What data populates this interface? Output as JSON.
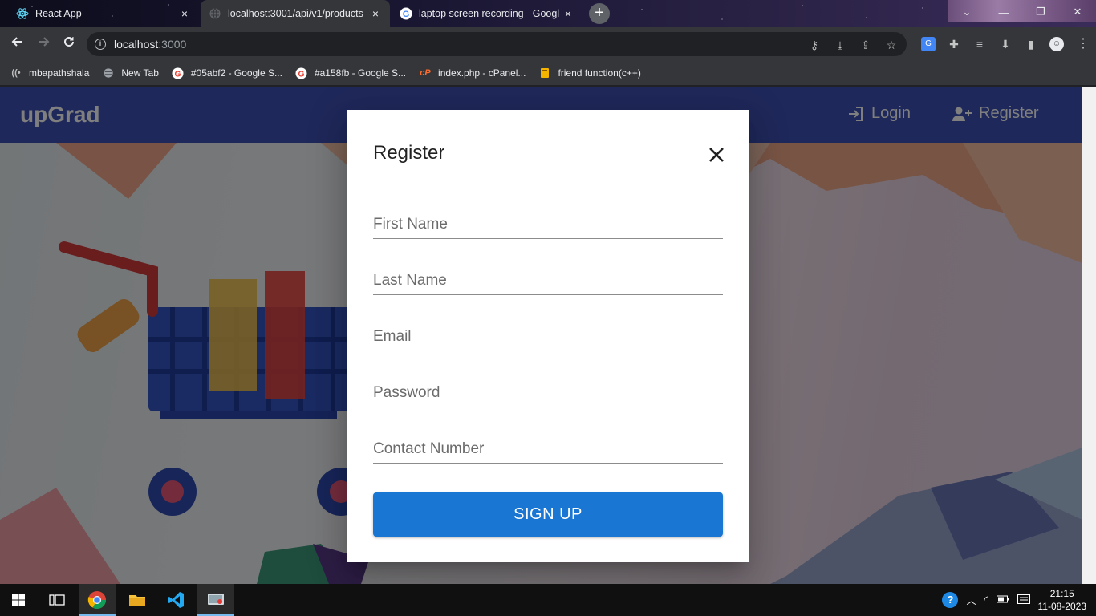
{
  "browser": {
    "tabs": [
      {
        "title": "React App",
        "icon": "react-icon",
        "close": "×"
      },
      {
        "title": "localhost:3001/api/v1/products",
        "icon": "globe-icon",
        "close": "×"
      },
      {
        "title": "laptop screen recording - Googl",
        "icon": "google-icon",
        "close": "×"
      }
    ],
    "new_tab": "+",
    "window_controls": {
      "chevron": "⌄",
      "minimize": "—",
      "restore": "❐",
      "close": "✕"
    },
    "address": {
      "host": "localhost",
      "port": ":3000"
    },
    "bookmarks": [
      {
        "label": "mbapathshala",
        "icon": "mba-icon"
      },
      {
        "label": "New Tab",
        "icon": "globe-icon"
      },
      {
        "label": "#05abf2 - Google S...",
        "icon": "google-icon"
      },
      {
        "label": "#a158fb - Google S...",
        "icon": "google-icon"
      },
      {
        "label": "index.php - cPanel...",
        "icon": "cpanel-icon"
      },
      {
        "label": "friend function(c++)",
        "icon": "bookmark-icon"
      }
    ]
  },
  "app": {
    "brand": "upGrad",
    "nav": {
      "login": "Login",
      "register": "Register"
    },
    "colors": {
      "appbar": "#3f51b5",
      "primary": "#1976d2"
    }
  },
  "dialog": {
    "title": "Register",
    "fields": {
      "first_name": "First Name",
      "last_name": "Last Name",
      "email": "Email",
      "password": "Password",
      "contact": "Contact Number"
    },
    "submit": "SIGN UP"
  },
  "taskbar": {
    "time": "21:15",
    "date": "11-08-2023"
  }
}
